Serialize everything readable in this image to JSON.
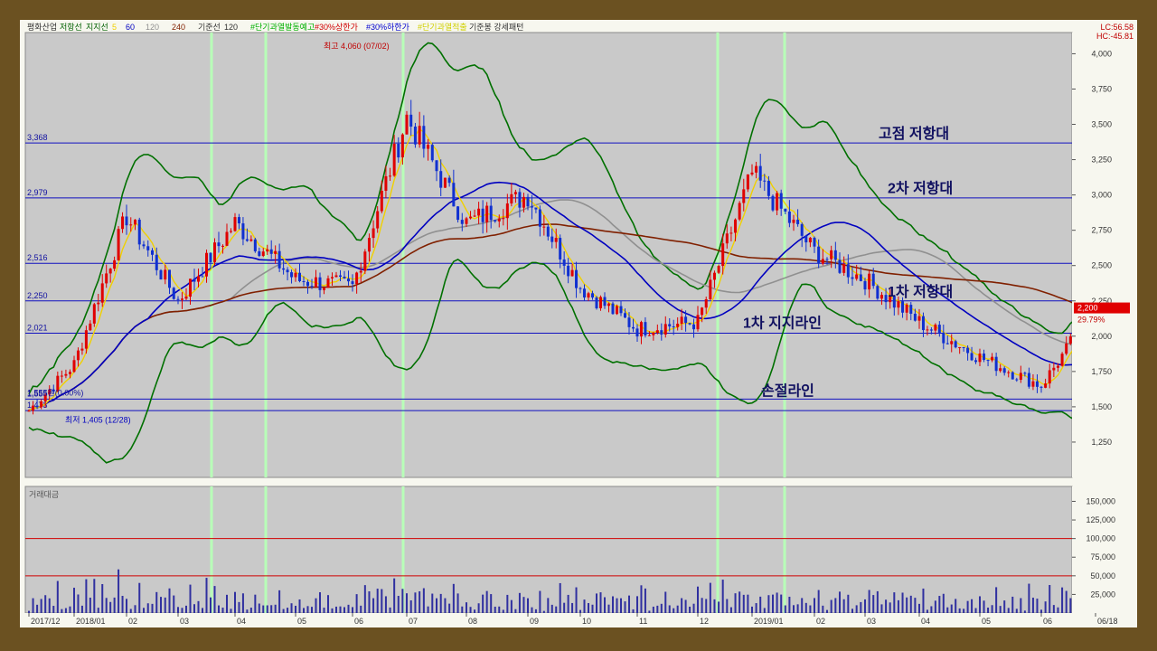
{
  "chart_data": {
    "type": "candlestick",
    "title": "",
    "legend_items": [
      {
        "label": "평화산업",
        "color": "#303030"
      },
      {
        "label": "저항선",
        "color": "#006000"
      },
      {
        "label": "지지선",
        "color": "#006000"
      },
      {
        "label": "5",
        "color": "#f0d000"
      },
      {
        "label": "60",
        "color": "#0000c0"
      },
      {
        "label": "120",
        "color": "#909090"
      },
      {
        "label": "240",
        "color": "#802000"
      },
      {
        "label": "기준선",
        "color": "#303030"
      },
      {
        "label": "120",
        "color": "#303030"
      },
      {
        "label": "#단기과열발동예고",
        "color": "#00b000"
      },
      {
        "label": "#30%상한가",
        "color": "#d00000"
      },
      {
        "label": "#30%하한가",
        "color": "#0000d0"
      },
      {
        "label": "#단기과열적출",
        "color": "#d0d000"
      },
      {
        "label": "기준봉 강세패턴",
        "color": "#303030"
      }
    ],
    "top_right_labels": [
      "LC:56.58",
      "HC:-45.81"
    ],
    "ylim": [
      1000,
      4150
    ],
    "y_ticks": [
      1250,
      1500,
      1750,
      2000,
      2250,
      2500,
      2750,
      3000,
      3250,
      3500,
      3750,
      4000
    ],
    "y_tick_labels": [
      "1,250",
      "1,500",
      "1,750",
      "2,000",
      "2,250",
      "2,500",
      "2,750",
      "3,000",
      "3,250",
      "3,500",
      "3,750",
      "4,000"
    ],
    "x_tick_labels": [
      "2017/12",
      "2018/01",
      "02",
      "03",
      "04",
      "05",
      "06",
      "07",
      "08",
      "09",
      "10",
      "11",
      "12",
      "2019/01",
      "02",
      "03",
      "04",
      "05",
      "06",
      "06/18"
    ],
    "horizontal_levels": [
      {
        "value": 3368,
        "label": "3,368"
      },
      {
        "value": 2979,
        "label": "2,979"
      },
      {
        "value": 2516,
        "label": "2,516"
      },
      {
        "value": 2250,
        "label": "2,250"
      },
      {
        "value": 2021,
        "label": "2,021"
      },
      {
        "value": 1555,
        "label": "1,555"
      },
      {
        "value": 1473,
        "label": "1,473"
      }
    ],
    "annotations": [
      {
        "text": "고점 저항대",
        "value": 3400
      },
      {
        "text": "2차 저항대",
        "value": 3015
      },
      {
        "text": "1차 저항대",
        "value": 2280
      },
      {
        "text": "1차 지지라인",
        "value": 2060
      },
      {
        "text": "손절라인",
        "value": 1580
      }
    ],
    "high_label": "최고 4,060 (07/02)",
    "low_label": "최저 1,405 (12/28)",
    "left_small_label": "1,555원(0.00%)",
    "current_price_label": "2,200",
    "current_change_label": "29.79%",
    "key_prices": [
      {
        "date": "2017/12",
        "close": 1473
      },
      {
        "date": "2018/01",
        "close": 1800
      },
      {
        "date": "02",
        "close": 2850
      },
      {
        "date": "03",
        "close": 2250
      },
      {
        "date": "04",
        "close": 2800
      },
      {
        "date": "05",
        "close": 2400
      },
      {
        "date": "06",
        "close": 2350
      },
      {
        "date": "07",
        "close": 3550
      },
      {
        "date": "08",
        "close": 2800
      },
      {
        "date": "09",
        "close": 3000
      },
      {
        "date": "10",
        "close": 2350
      },
      {
        "date": "11",
        "close": 2050
      },
      {
        "date": "12",
        "close": 2100
      },
      {
        "date": "2019/01",
        "close": 3150
      },
      {
        "date": "02",
        "close": 2600
      },
      {
        "date": "03",
        "close": 2400
      },
      {
        "date": "04",
        "close": 2100
      },
      {
        "date": "05",
        "close": 1850
      },
      {
        "date": "06",
        "close": 1650
      },
      {
        "date": "06/18",
        "close": 2200
      }
    ],
    "volume_panel": {
      "title": "거래대금",
      "ylim": [
        0,
        170000
      ],
      "y_ticks": [
        25000,
        50000,
        75000,
        100000,
        125000,
        150000
      ],
      "y_tick_labels": [
        "25,000",
        "50,000",
        "75,000",
        "100,000",
        "125,000",
        "150,000"
      ],
      "reference_lines": [
        100000,
        50000
      ]
    }
  }
}
